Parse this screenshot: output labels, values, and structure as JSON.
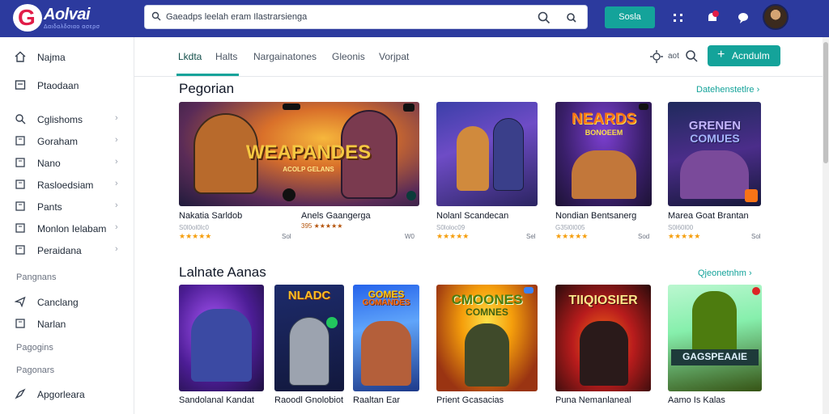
{
  "app": {
    "brand": "Aolvai",
    "brand_sub": "Δαιδαλδσιαο ασερσ"
  },
  "search": {
    "text": "Gaeadps leelah eram Ilastrarsienga"
  },
  "topbar": {
    "button_label": "Sosla"
  },
  "sidebar": {
    "items_top": [
      {
        "label": "Najma",
        "icon": "home-icon"
      },
      {
        "label": "Ptaodaan",
        "icon": "library-icon"
      }
    ],
    "items_main": [
      {
        "label": "Cglishoms",
        "icon": "search-icon"
      },
      {
        "label": "Goraham",
        "icon": "grid-icon"
      },
      {
        "label": "Nano",
        "icon": "grid-icon"
      },
      {
        "label": "Rasloedsiam",
        "icon": "grid-icon"
      },
      {
        "label": "Pants",
        "icon": "grid-icon"
      },
      {
        "label": "Monlon Ielabam",
        "icon": "grid-icon"
      },
      {
        "label": "Peraidana",
        "icon": "grid-icon"
      }
    ],
    "head_1": "Pangnans",
    "items_sub": [
      {
        "label": "Canclang",
        "icon": "send-icon"
      },
      {
        "label": "Narlan",
        "icon": "grid-icon"
      }
    ],
    "head_2": "Pagogins",
    "head_3": "Pagonars",
    "items_bottom": [
      {
        "label": "Apgorleara",
        "icon": "share-icon"
      }
    ]
  },
  "tabs": [
    {
      "label": "Lkdta",
      "active": true
    },
    {
      "label": "Halts",
      "active": false
    },
    {
      "label": "Nargainatones",
      "active": false
    },
    {
      "label": "Gleonis",
      "active": false
    },
    {
      "label": "Vorjpat",
      "active": false
    }
  ],
  "toolbar": {
    "filter_label": "aot",
    "create_label": "Acndulm"
  },
  "section1": {
    "title": "Pegorian",
    "see_all": "Datehenstetlre",
    "cards": [
      {
        "title": "Nakatia Sarldob",
        "meta": "S0l0ol0lc0",
        "price": "Sol",
        "art_text": "WEAPANDES",
        "art_sub": "ACOLP GELANS"
      },
      {
        "title": "Anels Gaangerga",
        "meta": "395 ★★★★★",
        "price": "W0",
        "art_text": "",
        "art_sub": ""
      },
      {
        "title": "Nolanl Scandecan",
        "meta": "S0loloc09",
        "price": "Sel",
        "art_text": "",
        "art_sub": ""
      },
      {
        "title": "Nondian Bentsanerg",
        "meta": "G35l0l005",
        "price": "Sod",
        "art_text": "NEARDS",
        "art_sub": "BONOEEM"
      },
      {
        "title": "Marea Goat Brantan",
        "meta": "S0l60l00",
        "price": "Sol",
        "art_text": "GRENEN",
        "art_sub": "COMUES"
      }
    ]
  },
  "section2": {
    "title": "Lalnate Aanas",
    "see_all": "Qjeonetnhm",
    "cards": [
      {
        "title": "Sandolanal Kandat",
        "art_text": "",
        "art_sub": ""
      },
      {
        "title": "Raoodl Gnolobiot",
        "art_text": "NLADC",
        "art_sub": ""
      },
      {
        "title": "Raaltan Ear",
        "art_text": "GOMES",
        "art_sub": "GOMANDES"
      },
      {
        "title": "Prient Gcasacias",
        "art_text": "CMOONES",
        "art_sub": "COMNES"
      },
      {
        "title": "Puna Nemanlaneal",
        "art_text": "TIIQIOSIER",
        "art_sub": ""
      },
      {
        "title": "Aamo Is Kalas",
        "art_text": "GAGSPEAAIE",
        "art_sub": ""
      }
    ]
  }
}
